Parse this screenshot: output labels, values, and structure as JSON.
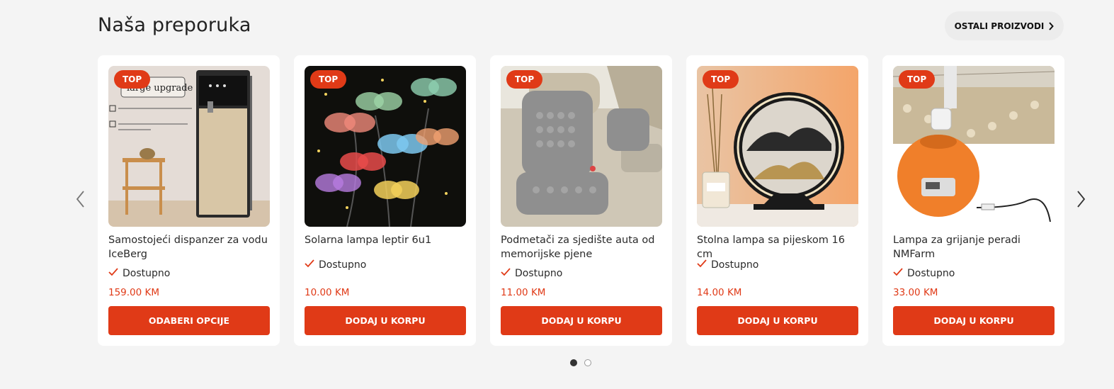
{
  "section": {
    "title": "Naša preporuka",
    "more_label": "OSTALI PROIZVODI"
  },
  "badge_label": "TOP",
  "stock_label": "Dostupno",
  "products": [
    {
      "title": "Samostojeći dispanzer za vodu IceBerg",
      "price": "159.00 KM",
      "button": "ODABERI OPCIJE",
      "image_text": "large upgrade"
    },
    {
      "title": "Solarna lampa leptir 6u1",
      "price": "10.00 KM",
      "button": "DODAJ U KORPU"
    },
    {
      "title": "Podmetači za sjedište auta od memorijske pjene",
      "price": "11.00 KM",
      "button": "DODAJ U KORPU"
    },
    {
      "title": "Stolna lampa sa pijeskom 16 cm",
      "price": "14.00 KM",
      "button": "DODAJ U KORPU"
    },
    {
      "title": "Lampa za grijanje peradi NMFarm",
      "price": "33.00 KM",
      "button": "DODAJ U KORPU"
    }
  ],
  "carousel": {
    "pages": 2,
    "active_page": 1
  },
  "colors": {
    "accent": "#e03a17",
    "background": "#f4f4f4",
    "card": "#ffffff"
  },
  "icons": {
    "prev": "chevron-left-icon",
    "next": "chevron-right-icon",
    "more": "chevron-right-icon",
    "stock": "checkmark-icon"
  }
}
